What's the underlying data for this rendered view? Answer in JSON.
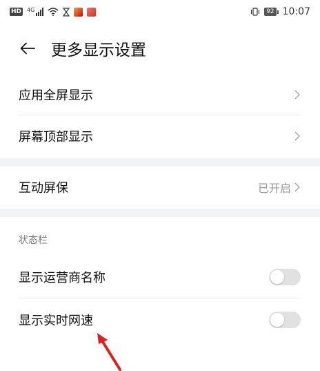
{
  "status_bar": {
    "hd": "HD",
    "network": "4G",
    "battery": "92",
    "time": "10:07"
  },
  "header": {
    "title": "更多显示设置"
  },
  "rows": [
    {
      "label": "应用全屏显示"
    },
    {
      "label": "屏幕顶部显示"
    },
    {
      "label": "互动屏保",
      "value": "已开启"
    }
  ],
  "status_section": {
    "header": "状态栏",
    "items": [
      {
        "label": "显示运营商名称",
        "enabled": false
      },
      {
        "label": "显示实时网速",
        "enabled": false
      }
    ]
  },
  "colors": {
    "annotation_arrow": "#e02020",
    "toggle_off": "#e1e1e1",
    "section_gap": "#f1f3f5"
  }
}
